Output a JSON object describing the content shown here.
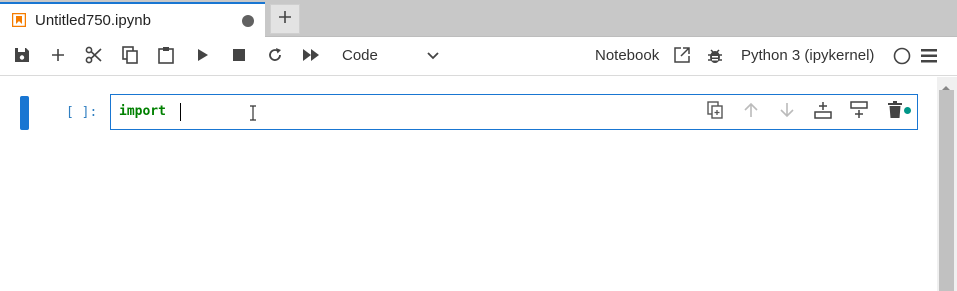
{
  "tab": {
    "title": "Untitled750.ipynb",
    "icon": "notebook-icon",
    "unsaved_indicator": "unsaved-dot"
  },
  "new_tab": {
    "icon": "plus-icon"
  },
  "toolbar": {
    "buttons": [
      "save-icon",
      "insert-cell-icon",
      "cut-icon",
      "copy-icon",
      "paste-icon",
      "run-icon",
      "stop-icon",
      "restart-icon",
      "run-all-icon"
    ],
    "cell_type": "Code",
    "notebook_label": "Notebook",
    "kernel_name": "Python 3 (ipykernel)",
    "kernel_status": "idle",
    "menu_icon": "hamburger-icon"
  },
  "cell": {
    "prompt": "[ ]:",
    "code": "import",
    "actions": [
      "duplicate-icon",
      "move-up-icon",
      "move-down-icon",
      "insert-above-icon",
      "insert-below-icon",
      "delete-icon"
    ]
  },
  "colors": {
    "accent": "#1976d2",
    "code_keyword": "#008000",
    "prompt": "#307fc1",
    "status_dot": "#009688"
  }
}
